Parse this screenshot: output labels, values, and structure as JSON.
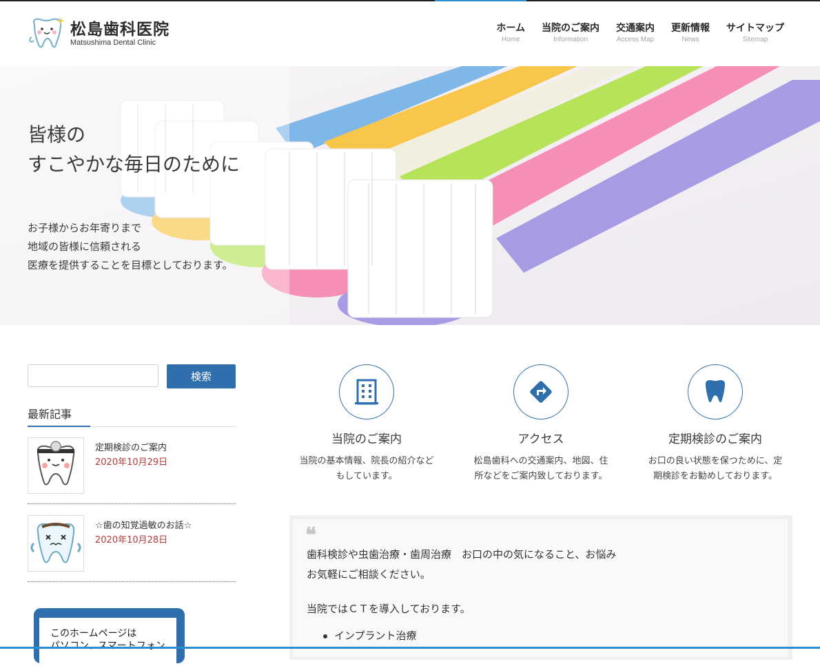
{
  "header": {
    "logo_title": "松島歯科医院",
    "logo_sub": "Matsushima Dental Clinic",
    "nav": [
      {
        "label": "ホーム",
        "sub": "Home"
      },
      {
        "label": "当院のご案内",
        "sub": "Information"
      },
      {
        "label": "交通案内",
        "sub": "Access Map"
      },
      {
        "label": "更新情報",
        "sub": "News"
      },
      {
        "label": "サイトマップ",
        "sub": "Sitemap"
      }
    ]
  },
  "hero": {
    "title_line1": "皆様の",
    "title_line2": "すこやかな毎日のために",
    "text_line1": "お子様からお年寄りまで",
    "text_line2": "地域の皆様に信頼される",
    "text_line3": "医療を提供することを目標としております。"
  },
  "sidebar": {
    "search_placeholder": "",
    "search_button": "検索",
    "recent_title": "最新記事",
    "posts": [
      {
        "title": "定期検診のご案内",
        "date": "2020年10月29日"
      },
      {
        "title": "☆歯の知覚過敏のお話☆",
        "date": "2020年10月28日"
      }
    ],
    "notice_line1": "このホームページは",
    "notice_line2": "パソコン、スマートフォン"
  },
  "features": [
    {
      "title": "当院のご案内",
      "desc_line1": "当院の基本情報、院長の紹介など",
      "desc_line2": "もしています。"
    },
    {
      "title": "アクセス",
      "desc_line1": "松島歯科への交通案内、地図、住",
      "desc_line2": "所などをご案内致しております。"
    },
    {
      "title": "定期検診のご案内",
      "desc_line1": "お口の良い状態を保つために、定",
      "desc_line2": "期検診をお勧めしております。"
    }
  ],
  "content": {
    "quote": "❝",
    "line1": "歯科検診や虫歯治療・歯周治療　お口の中の気になること、お悩み",
    "line2": "お気軽にご相談ください。",
    "line3": "当院ではＣＴを導入しております。",
    "bullet1": "インプラント治療"
  },
  "colors": {
    "accent": "#2f6fae",
    "date": "#b33b3b",
    "topline": "#2a8fd0"
  }
}
